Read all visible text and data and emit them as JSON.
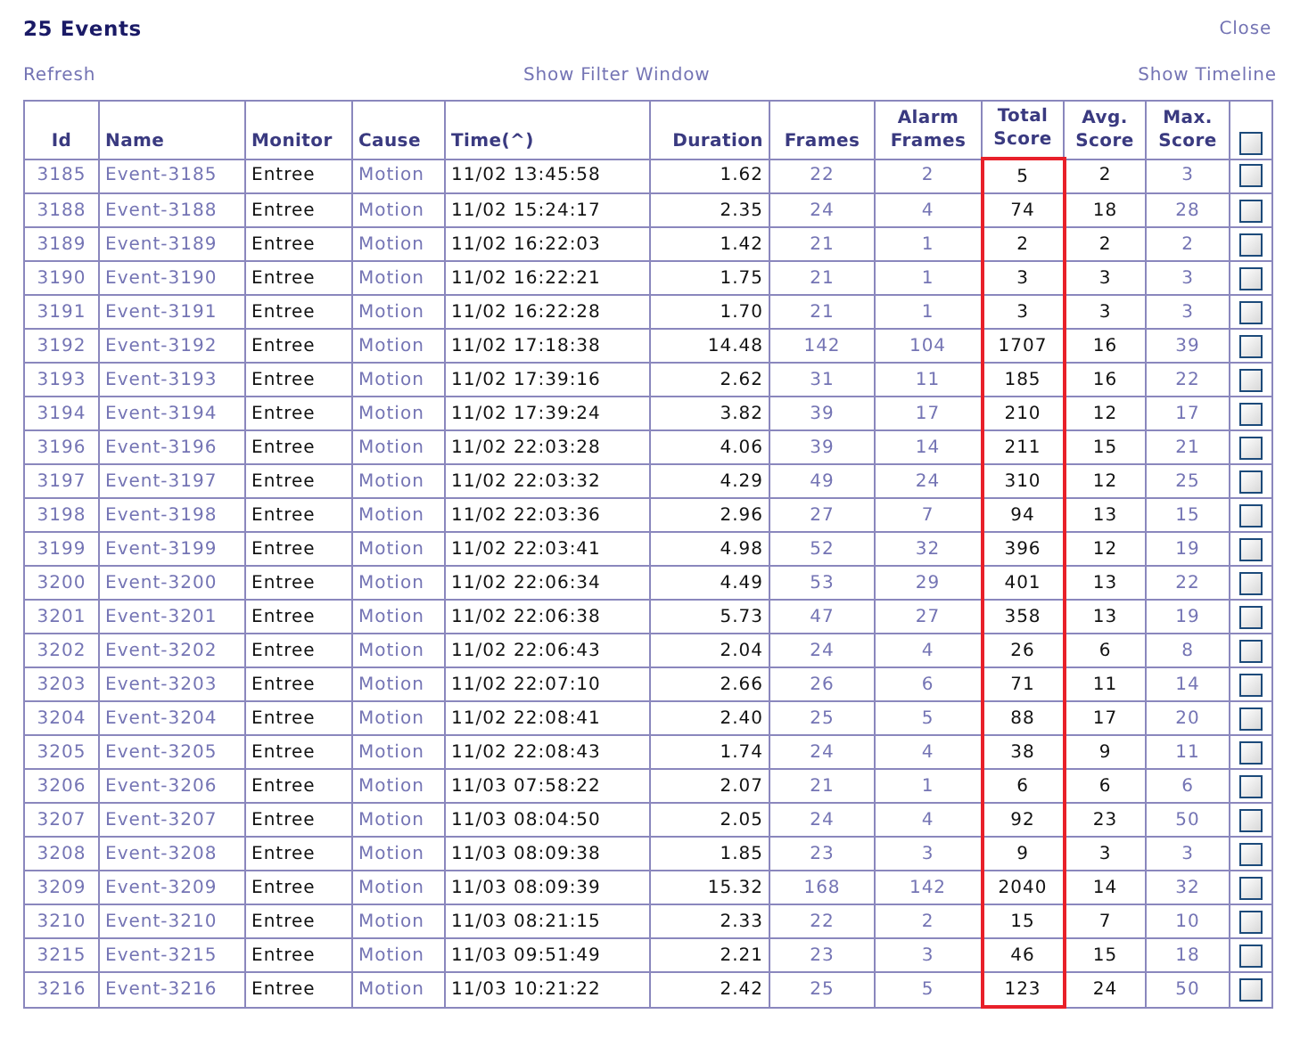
{
  "title": "25 Events",
  "close_link": "Close",
  "toolbar": [
    {
      "label": "Refresh"
    },
    {
      "label": "Show Filter Window"
    },
    {
      "label": "Show Timeline"
    }
  ],
  "columns": [
    {
      "label": "Id",
      "kind": "link",
      "highlighted": false
    },
    {
      "label": "Name",
      "kind": "link",
      "highlighted": false
    },
    {
      "label": "Monitor",
      "kind": "text",
      "highlighted": false
    },
    {
      "label": "Cause",
      "kind": "link",
      "highlighted": false
    },
    {
      "label": "Time(^)",
      "kind": "text",
      "highlighted": false
    },
    {
      "label": "Duration",
      "kind": "text",
      "highlighted": false
    },
    {
      "label": "Frames",
      "kind": "link",
      "highlighted": false
    },
    {
      "label": "Alarm Frames",
      "kind": "link",
      "highlighted": false
    },
    {
      "label": "Total Score",
      "kind": "text",
      "highlighted": true
    },
    {
      "label": "Avg. Score",
      "kind": "text",
      "highlighted": false
    },
    {
      "label": "Max. Score",
      "kind": "link",
      "highlighted": false
    }
  ],
  "select_all_checked": false,
  "rows": [
    {
      "cells": [
        "3185",
        "Event-3185",
        "Entree",
        "Motion",
        "11/02 13:45:58",
        "1.62",
        "22",
        "2",
        "5",
        "2",
        "3"
      ],
      "checked": false
    },
    {
      "cells": [
        "3188",
        "Event-3188",
        "Entree",
        "Motion",
        "11/02 15:24:17",
        "2.35",
        "24",
        "4",
        "74",
        "18",
        "28"
      ],
      "checked": false
    },
    {
      "cells": [
        "3189",
        "Event-3189",
        "Entree",
        "Motion",
        "11/02 16:22:03",
        "1.42",
        "21",
        "1",
        "2",
        "2",
        "2"
      ],
      "checked": false
    },
    {
      "cells": [
        "3190",
        "Event-3190",
        "Entree",
        "Motion",
        "11/02 16:22:21",
        "1.75",
        "21",
        "1",
        "3",
        "3",
        "3"
      ],
      "checked": false
    },
    {
      "cells": [
        "3191",
        "Event-3191",
        "Entree",
        "Motion",
        "11/02 16:22:28",
        "1.70",
        "21",
        "1",
        "3",
        "3",
        "3"
      ],
      "checked": false
    },
    {
      "cells": [
        "3192",
        "Event-3192",
        "Entree",
        "Motion",
        "11/02 17:18:38",
        "14.48",
        "142",
        "104",
        "1707",
        "16",
        "39"
      ],
      "checked": false
    },
    {
      "cells": [
        "3193",
        "Event-3193",
        "Entree",
        "Motion",
        "11/02 17:39:16",
        "2.62",
        "31",
        "11",
        "185",
        "16",
        "22"
      ],
      "checked": false
    },
    {
      "cells": [
        "3194",
        "Event-3194",
        "Entree",
        "Motion",
        "11/02 17:39:24",
        "3.82",
        "39",
        "17",
        "210",
        "12",
        "17"
      ],
      "checked": false
    },
    {
      "cells": [
        "3196",
        "Event-3196",
        "Entree",
        "Motion",
        "11/02 22:03:28",
        "4.06",
        "39",
        "14",
        "211",
        "15",
        "21"
      ],
      "checked": false
    },
    {
      "cells": [
        "3197",
        "Event-3197",
        "Entree",
        "Motion",
        "11/02 22:03:32",
        "4.29",
        "49",
        "24",
        "310",
        "12",
        "25"
      ],
      "checked": false
    },
    {
      "cells": [
        "3198",
        "Event-3198",
        "Entree",
        "Motion",
        "11/02 22:03:36",
        "2.96",
        "27",
        "7",
        "94",
        "13",
        "15"
      ],
      "checked": false
    },
    {
      "cells": [
        "3199",
        "Event-3199",
        "Entree",
        "Motion",
        "11/02 22:03:41",
        "4.98",
        "52",
        "32",
        "396",
        "12",
        "19"
      ],
      "checked": false
    },
    {
      "cells": [
        "3200",
        "Event-3200",
        "Entree",
        "Motion",
        "11/02 22:06:34",
        "4.49",
        "53",
        "29",
        "401",
        "13",
        "22"
      ],
      "checked": false
    },
    {
      "cells": [
        "3201",
        "Event-3201",
        "Entree",
        "Motion",
        "11/02 22:06:38",
        "5.73",
        "47",
        "27",
        "358",
        "13",
        "19"
      ],
      "checked": false
    },
    {
      "cells": [
        "3202",
        "Event-3202",
        "Entree",
        "Motion",
        "11/02 22:06:43",
        "2.04",
        "24",
        "4",
        "26",
        "6",
        "8"
      ],
      "checked": false
    },
    {
      "cells": [
        "3203",
        "Event-3203",
        "Entree",
        "Motion",
        "11/02 22:07:10",
        "2.66",
        "26",
        "6",
        "71",
        "11",
        "14"
      ],
      "checked": false
    },
    {
      "cells": [
        "3204",
        "Event-3204",
        "Entree",
        "Motion",
        "11/02 22:08:41",
        "2.40",
        "25",
        "5",
        "88",
        "17",
        "20"
      ],
      "checked": false
    },
    {
      "cells": [
        "3205",
        "Event-3205",
        "Entree",
        "Motion",
        "11/02 22:08:43",
        "1.74",
        "24",
        "4",
        "38",
        "9",
        "11"
      ],
      "checked": false
    },
    {
      "cells": [
        "3206",
        "Event-3206",
        "Entree",
        "Motion",
        "11/03 07:58:22",
        "2.07",
        "21",
        "1",
        "6",
        "6",
        "6"
      ],
      "checked": false
    },
    {
      "cells": [
        "3207",
        "Event-3207",
        "Entree",
        "Motion",
        "11/03 08:04:50",
        "2.05",
        "24",
        "4",
        "92",
        "23",
        "50"
      ],
      "checked": false
    },
    {
      "cells": [
        "3208",
        "Event-3208",
        "Entree",
        "Motion",
        "11/03 08:09:38",
        "1.85",
        "23",
        "3",
        "9",
        "3",
        "3"
      ],
      "checked": false
    },
    {
      "cells": [
        "3209",
        "Event-3209",
        "Entree",
        "Motion",
        "11/03 08:09:39",
        "15.32",
        "168",
        "142",
        "2040",
        "14",
        "32"
      ],
      "checked": false
    },
    {
      "cells": [
        "3210",
        "Event-3210",
        "Entree",
        "Motion",
        "11/03 08:21:15",
        "2.33",
        "22",
        "2",
        "15",
        "7",
        "10"
      ],
      "checked": false
    },
    {
      "cells": [
        "3215",
        "Event-3215",
        "Entree",
        "Motion",
        "11/03 09:51:49",
        "2.21",
        "23",
        "3",
        "46",
        "15",
        "18"
      ],
      "checked": false
    },
    {
      "cells": [
        "3216",
        "Event-3216",
        "Entree",
        "Motion",
        "11/03 10:21:22",
        "2.42",
        "25",
        "5",
        "123",
        "24",
        "50"
      ],
      "checked": false
    }
  ]
}
